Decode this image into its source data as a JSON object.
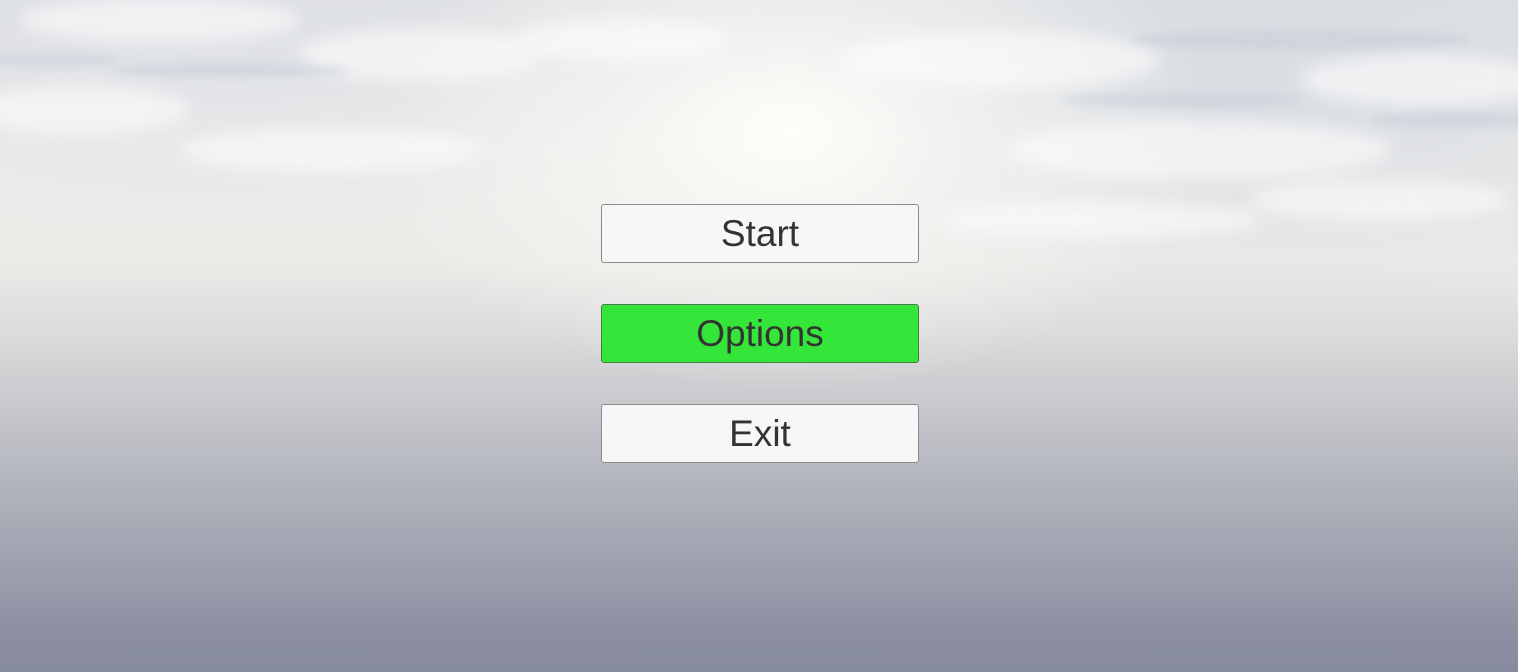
{
  "menu": {
    "buttons": [
      {
        "label": "Start",
        "selected": false
      },
      {
        "label": "Options",
        "selected": true
      },
      {
        "label": "Exit",
        "selected": false
      }
    ]
  },
  "colors": {
    "button_background": "#f7f7f7",
    "selected_background": "#35e63a",
    "button_text": "#333333",
    "button_border": "#8a8a8a"
  }
}
